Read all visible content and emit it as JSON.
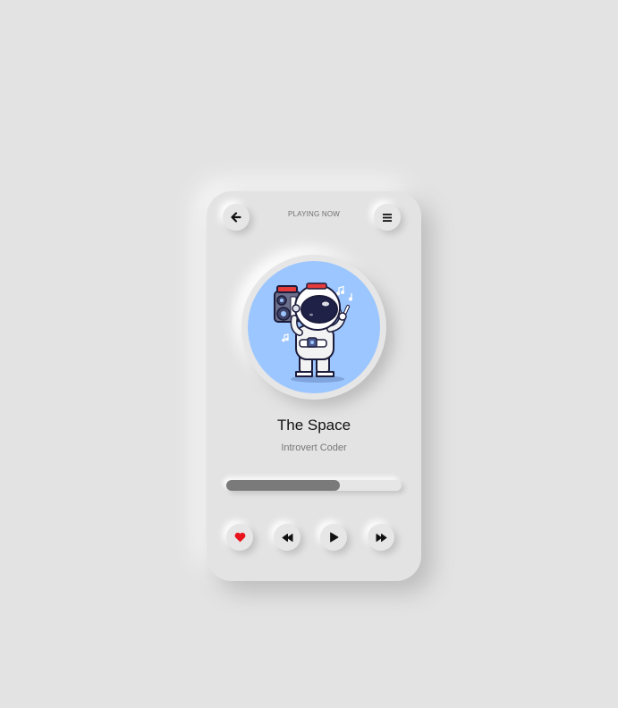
{
  "header": {
    "title": "PLAYING NOW",
    "back_icon": "arrow-left-icon",
    "menu_icon": "hamburger-menu-icon"
  },
  "track": {
    "title": "The Space",
    "artist": "Introvert Coder",
    "artwork": "astronaut-with-boombox-illustration",
    "progress_fraction": 0.65
  },
  "controls": {
    "like_icon": "heart-icon",
    "prev_icon": "rewind-icon",
    "play_icon": "play-icon",
    "next_icon": "fast-forward-icon"
  },
  "colors": {
    "background": "#e3e3e3",
    "artwork_bg": "#9cc6ff",
    "progress": "#7a7a7a",
    "heart": "#e8141e"
  }
}
